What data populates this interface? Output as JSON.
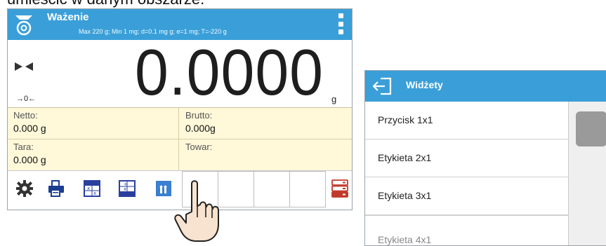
{
  "caption": "umieścić w danym obszarze.",
  "scale": {
    "title": "Ważenie",
    "info": "Max 220 g; Min 1 mg; d=0.1 mg g; e=1 mg; T=-220 g",
    "weight": "0.0000",
    "unit": "g",
    "zero_indicator": "→0←",
    "fields": {
      "netto_label": "Netto:",
      "netto_value": "0.000 g",
      "brutto_label": "Brutto:",
      "brutto_value": "0.000g",
      "tara_label": "Tara:",
      "tara_value": "0.000 g",
      "towar_label": "Towar:",
      "towar_value": ""
    },
    "toolbar_icons": [
      "gear-icon",
      "print-icon",
      "calculator-icon",
      "calculator-minus-icon",
      "chart-up-icon",
      "empty-slot",
      "empty-slot",
      "empty-slot",
      "empty-slot",
      "database-icon"
    ],
    "colors": {
      "header": "#3a9fd8",
      "info_panel": "#fff8d9"
    }
  },
  "widgets": {
    "title": "Widżety",
    "items": [
      "Przycisk 1x1",
      "Etykieta 2x1",
      "Etykieta 3x1",
      "Etykieta 4x1"
    ]
  }
}
